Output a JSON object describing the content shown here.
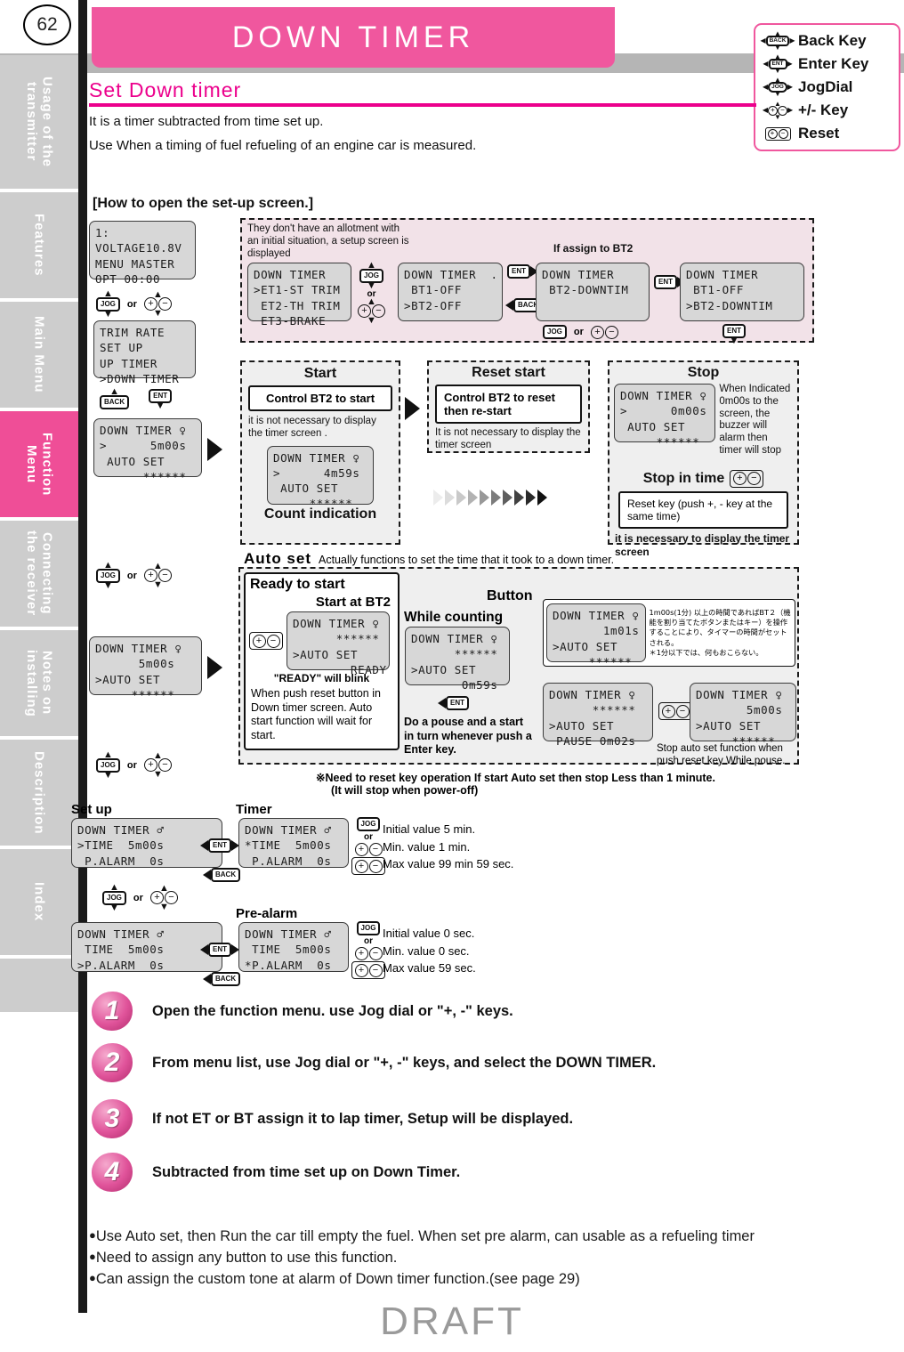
{
  "page": {
    "number": "62",
    "banner_title": "DOWN TIMER",
    "section_title": "Set Down timer",
    "lead_1": "It is a timer subtracted from time set up.",
    "lead_2": "Use When a timing of fuel refueling of an engine car is measured.",
    "howto_heading": "[How to open the set-up screen.]",
    "watermark": "DRAFT",
    "accent_pink": "#ec008c",
    "banner_pink": "#f0579e",
    "band_gray": "#b5b5b5"
  },
  "key_legend": [
    {
      "glyph": "back-key-icon",
      "code": "BACK",
      "label": "Back Key"
    },
    {
      "glyph": "enter-key-icon",
      "code": "ENT",
      "label": "Enter Key"
    },
    {
      "glyph": "jogdial-icon",
      "code": "JOG",
      "label": "JogDial"
    },
    {
      "glyph": "plus-minus-key-icon",
      "code": "+-",
      "label": "+/- Key"
    },
    {
      "glyph": "reset-key-icon",
      "code": "+-",
      "label": "Reset"
    }
  ],
  "sidebar": {
    "items": [
      {
        "label": "Usage of the transmitter",
        "active": false
      },
      {
        "label": "Features",
        "active": false
      },
      {
        "label": "Main Menu",
        "active": false
      },
      {
        "label": "Function Menu",
        "active": true
      },
      {
        "label": "Connecting the receiver",
        "active": false
      },
      {
        "label": "Notes on installing",
        "active": false
      },
      {
        "label": "Description",
        "active": false
      },
      {
        "label": "Index",
        "active": false
      }
    ]
  },
  "flow": {
    "screen_home": "1:\nVOLTAGE10.8V\nMENU MASTER\nOPT 00:00",
    "jog_or_label": "or",
    "screen_menu_list": "TRIM RATE\nSET UP\nUP TIMER\n>DOWN TIMER",
    "screen_downtimer_main": "DOWN TIMER ♀\n>      5m00s\n AUTO SET\n      ******",
    "screen_autoset_5m": "DOWN TIMER ♀\n      5m00s\n>AUTO SET\n     ******",
    "assign_note": "They don't have an allotment with an initial situation, a setup screen is displayed",
    "screen_assign_et": "DOWN TIMER\n>ET1-ST TRIM\n ET2-TH TRIM\n ET3-BRAKE",
    "screen_assign_bt": "DOWN TIMER  .\n BT1-OFF\n>BT2-OFF",
    "if_assign_bt2": "If assign to BT2",
    "screen_bt2_downtim": "DOWN TIMER\n BT2-DOWNTIM",
    "screen_bt_list_downtim": "DOWN TIMER\n BT1-OFF\n>BT2-DOWNTIM"
  },
  "start_panel": {
    "heading": "Start",
    "box_text": "Control BT2 to start",
    "note": "it is not necessary to display the timer screen .",
    "screen": "DOWN TIMER ♀\n>      4m59s\n AUTO SET\n     ******",
    "footer": "Count indication"
  },
  "reset_panel": {
    "heading": "Reset start",
    "box_text": "Control BT2 to reset then re-start",
    "note": "It is not necessary to display the timer screen"
  },
  "stop_panel": {
    "heading": "Stop",
    "screen": "DOWN TIMER ♀\n>      0m00s\n AUTO SET\n     ******",
    "note": "When Indicated 0m00s to the screen, the buzzer will alarm then timer will stop",
    "stop_in_time_heading": "Stop in time",
    "reset_key_box": "Reset key (push +, - key at the same time)",
    "necessary_note": "it is necessary to display the timer screen"
  },
  "autoset": {
    "title": "Auto set",
    "subtitle": "Actually functions to set the time that it took to a down timer.",
    "ready_heading": "Ready to start",
    "start_at_bt2": "Start at BT2",
    "screen_ready": "DOWN TIMER ♀\n      ******\n>AUTO SET\n        READY",
    "ready_blink_note": "\"READY\" will blink",
    "ready_body": "When push reset button in Down timer screen. Auto start function will wait for start.",
    "while_counting": "While counting",
    "screen_counting": "DOWN TIMER ♀\n      ******\n>AUTO SET\n       0m59s",
    "pause_note": "Do a pouse and a start in turn whenever push a Enter key.",
    "button_label": "Button",
    "screen_1m01": "DOWN TIMER ♀\n       1m01s\n>AUTO SET\n     ******",
    "jp_note": "1m00s(1分) 以上の時間であればBT２（機能を割り当てたボタンまたはキー）を操作することにより、タイマーの時間がセットされる。\n＊1分以下では、何もおこらない。",
    "screen_pause": "DOWN TIMER ♀\n      ******\n>AUTO SET\n PAUSE 0m02s",
    "screen_stop_5m": "DOWN TIMER ♀\n       5m00s\n>AUTO SET\n     ******",
    "stop_auto_note": "Stop auto set function when push reset key While pouse.",
    "warning_line1": "※Need to reset key operation If start Auto set then stop Less than 1 minute.",
    "warning_line2": "(It will stop when power-off)"
  },
  "setup_section": {
    "setup_label": "Set up",
    "timer_label": "Timer",
    "prealarm_label": "Pre-alarm",
    "screen_setup_time": "DOWN TIMER ♂\n>TIME  5m00s\n P.ALARM  0s",
    "screen_timer_edit": "DOWN TIMER ♂\n*TIME  5m00s\n P.ALARM  0s",
    "screen_setup_alarm": "DOWN TIMER ♂\n TIME  5m00s\n>P.ALARM  0s",
    "screen_prealarm_edit": "DOWN TIMER ♂\n TIME  5m00s\n*P.ALARM  0s",
    "timer_values": [
      "Initial value 5 min.",
      "Min. value 1 min.",
      "Max value 99 min 59 sec."
    ],
    "prealarm_values": [
      "Initial value 0 sec.",
      "Min. value 0 sec.",
      "Max value 59 sec."
    ],
    "or_label": "or"
  },
  "steps": [
    {
      "num": "1",
      "text": "Open the function menu. use Jog dial or \"+, -\" keys."
    },
    {
      "num": "2",
      "text": "From menu list, use Jog dial or \"+, -\" keys, and select the DOWN TIMER."
    },
    {
      "num": "3",
      "text": "If not ET or BT assign it to lap timer, Setup will be displayed."
    },
    {
      "num": "4",
      "text": "Subtracted from time set up on Down Timer."
    }
  ],
  "bullets": [
    "Use Auto set, then Run the car till empty the fuel. When set pre alarm, can usable as a refueling timer",
    "Need to assign any button to use this function.",
    "Can assign the custom tone at alarm of Down timer function.(see page 29)"
  ]
}
